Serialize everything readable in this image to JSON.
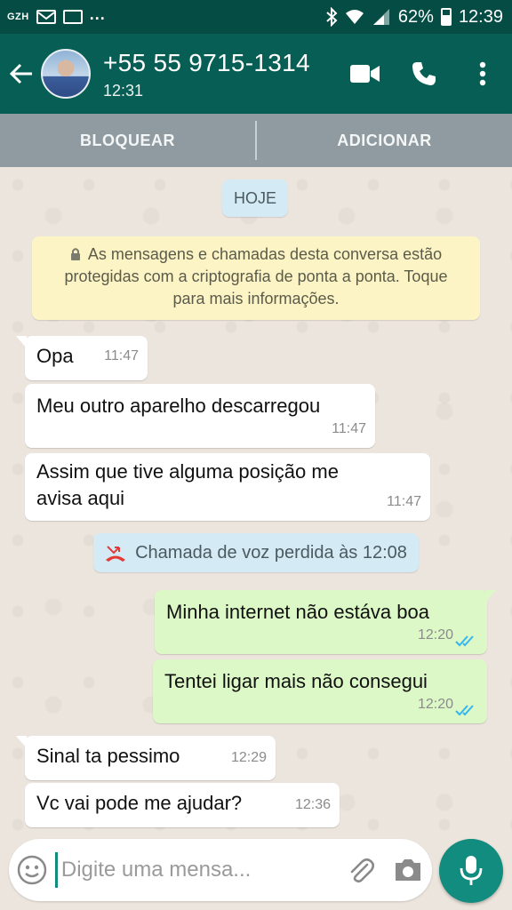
{
  "status_bar": {
    "left_tag": "GZH",
    "more": "...",
    "battery": "62%",
    "time": "12:39"
  },
  "header": {
    "contact_name": "+55 55 9715-1314",
    "last_seen": "12:31",
    "icons": [
      "back-arrow-icon",
      "video-call-icon",
      "phone-icon",
      "more-vert-icon"
    ]
  },
  "action_strip": {
    "block_label": "BLOQUEAR",
    "add_label": "ADICIONAR"
  },
  "chat": {
    "date_chip": "HOJE",
    "encryption_notice": "As mensagens e chamadas desta conversa estão protegidas com a criptografia de ponta a ponta. Toque para mais informações.",
    "missed_call": "Chamada de voz perdida às 12:08",
    "messages": [
      {
        "direction": "in",
        "lines": [
          "Opa"
        ],
        "time": "11:47"
      },
      {
        "direction": "in",
        "lines": [
          "Meu outro aparelho descarregou"
        ],
        "time": "11:47"
      },
      {
        "direction": "in",
        "lines": [
          "Assim que tive alguma posição me",
          "avisa aqui"
        ],
        "time": "11:47"
      },
      {
        "direction": "out",
        "lines": [
          "Minha internet não estáva boa"
        ],
        "time": "12:20",
        "status": "read"
      },
      {
        "direction": "out",
        "lines": [
          "Tentei ligar mais não consegui"
        ],
        "time": "12:20",
        "status": "read"
      },
      {
        "direction": "in",
        "lines": [
          "Sinal ta pessimo"
        ],
        "time": "12:29"
      },
      {
        "direction": "in",
        "lines": [
          "Vc vai pode me ajudar?"
        ],
        "time": "12:36"
      }
    ]
  },
  "composer": {
    "placeholder": "Digite uma mensa...",
    "value": ""
  },
  "colors": {
    "status_bar": "#054d44",
    "app_bar": "#075e54",
    "accent": "#128c7e",
    "outgoing_bubble": "#dcf8c6",
    "read_ticks": "#34b7f1"
  }
}
